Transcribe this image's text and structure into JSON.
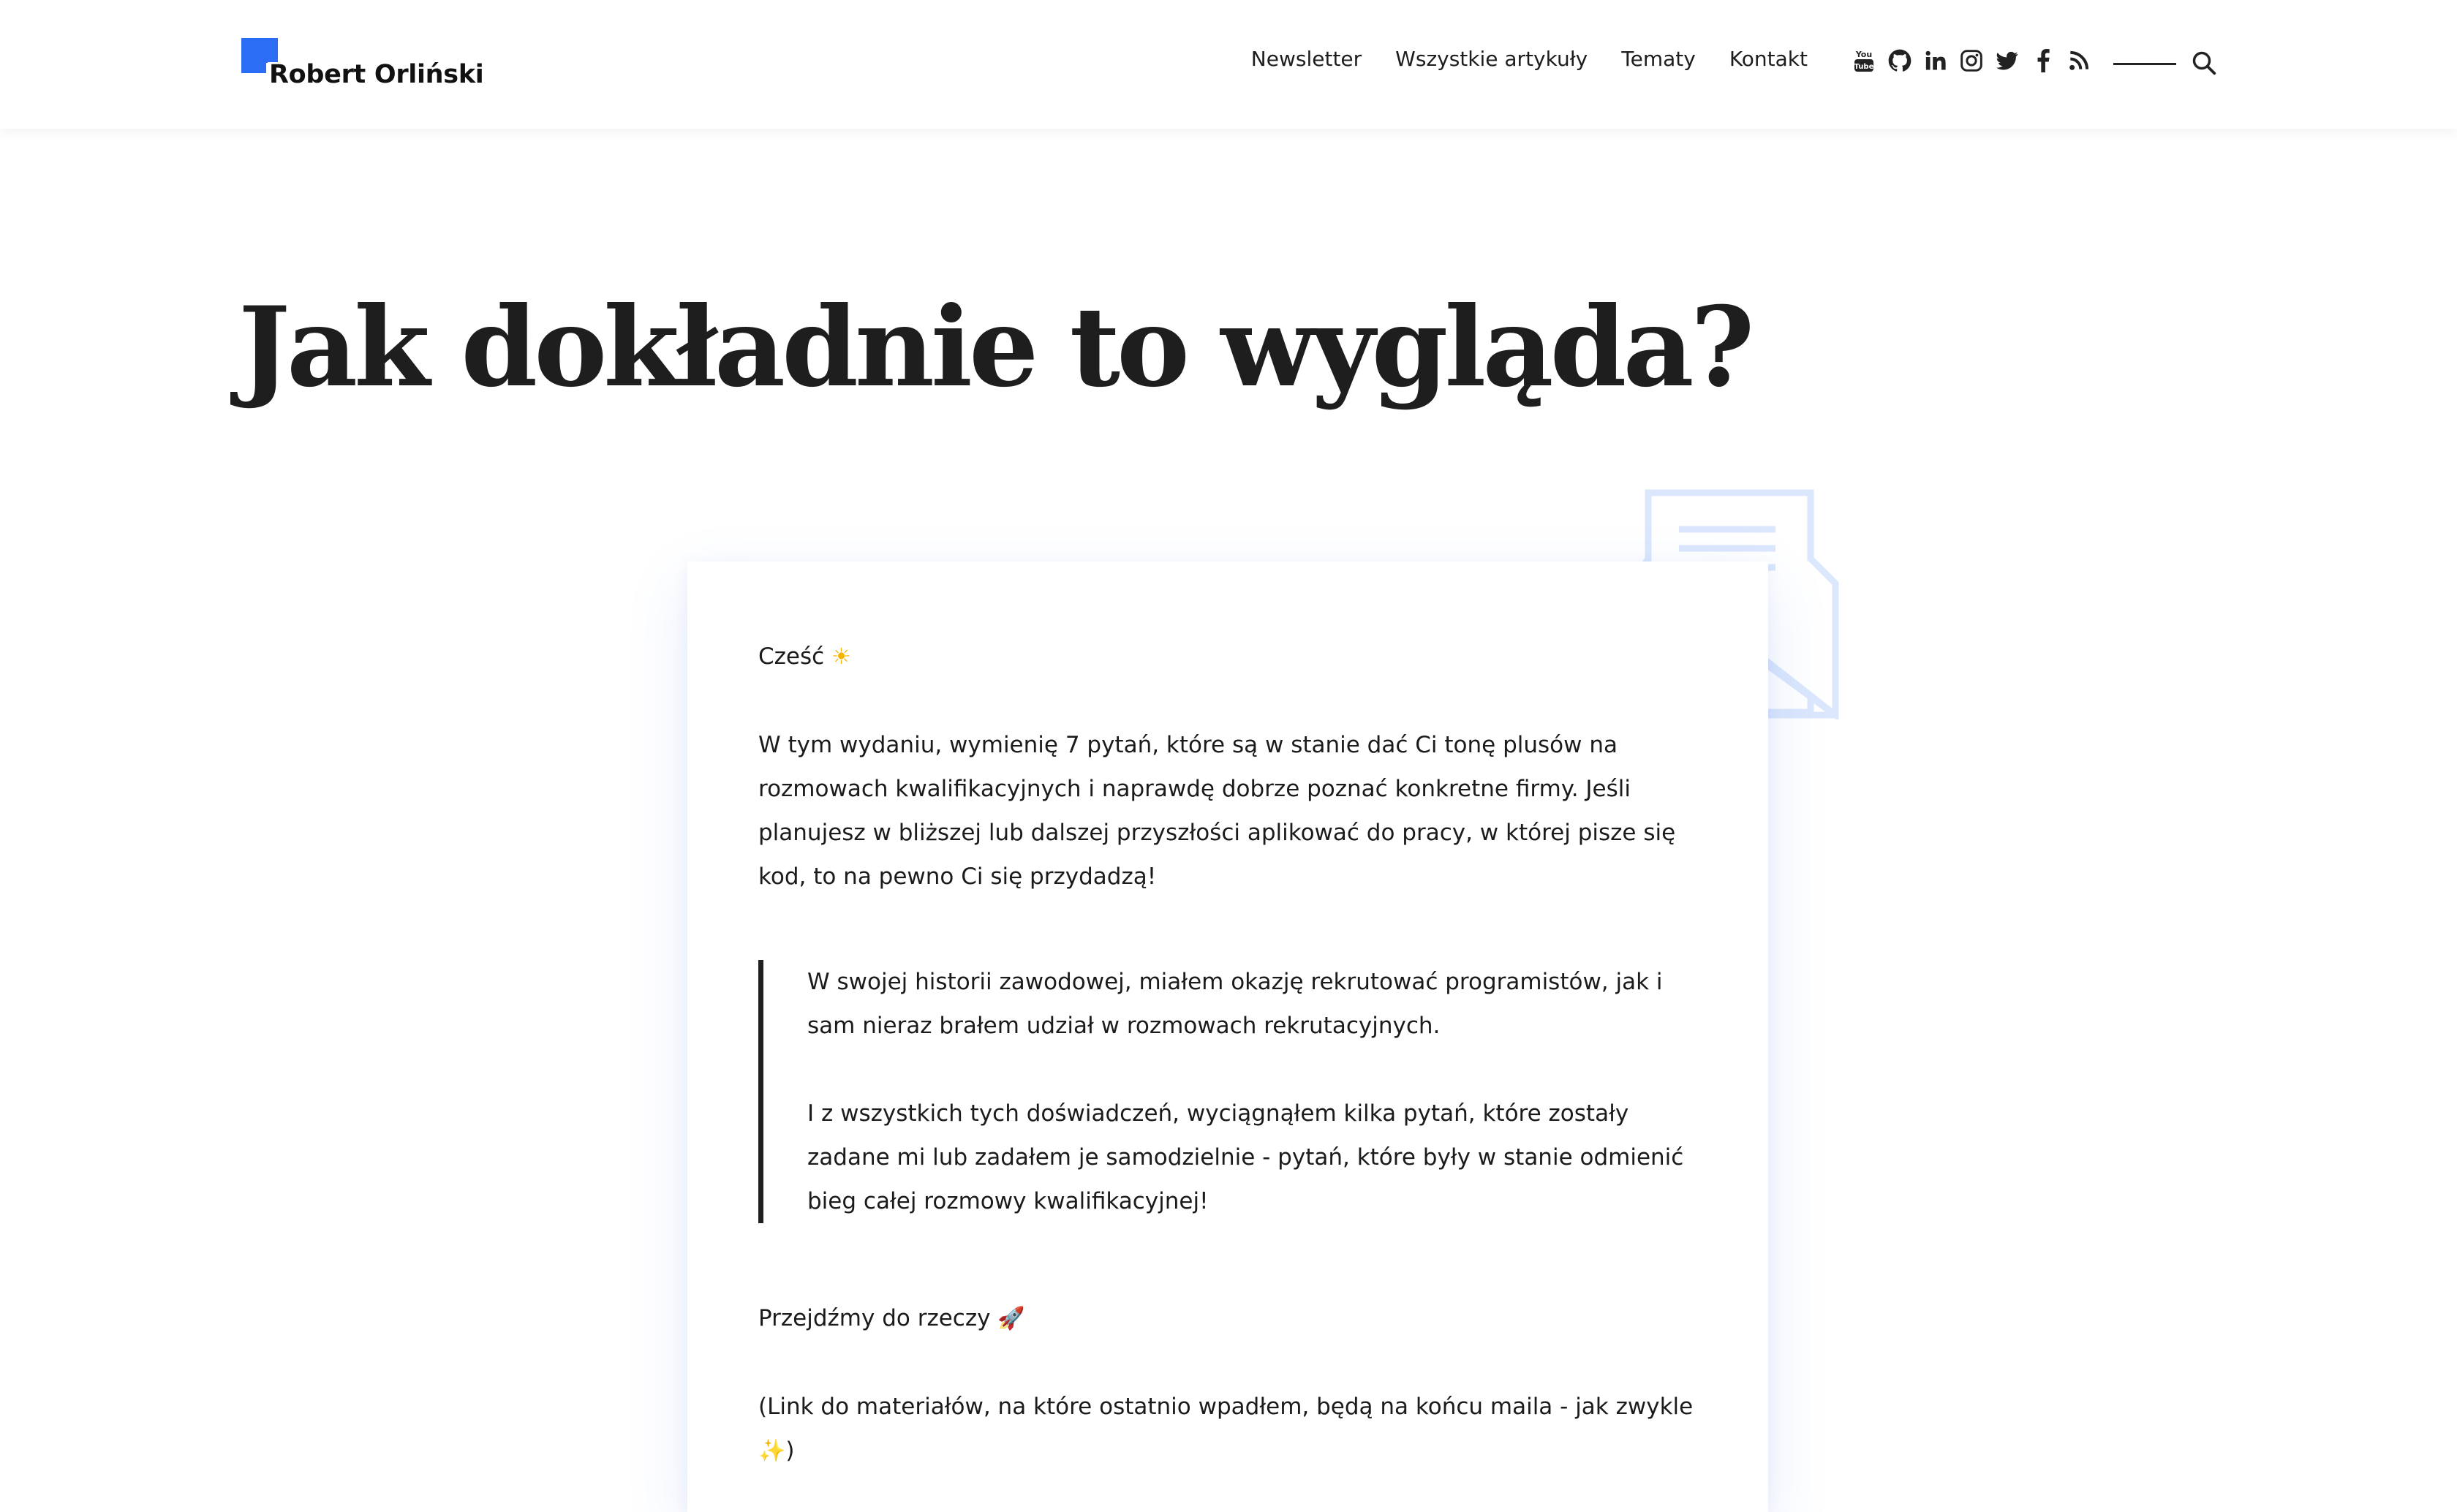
{
  "header": {
    "logo_text": "Robert Orliński",
    "nav": [
      "Newsletter",
      "Wszystkie artykuły",
      "Tematy",
      "Kontakt"
    ],
    "social_icons": [
      "youtube-icon",
      "github-icon",
      "linkedin-icon",
      "instagram-icon",
      "twitter-icon",
      "facebook-icon",
      "rss-icon"
    ],
    "search_icon": "search-icon",
    "brand_color": "#2b6ef5"
  },
  "title": "Jak dokładnie to wygląda?",
  "email": {
    "greeting": "Cześć",
    "greeting_emoji": "☀",
    "intro": "W tym wydaniu, wymienię 7 pytań, które są w stanie dać Ci tonę plusów na rozmowach kwalifikacyjnych i naprawdę dobrze poznać konkretne firmy. Jeśli planujesz w bliższej lub dalszej przyszłości aplikować do pracy, w której pisze się kod, to na pewno Ci się przydadzą!",
    "quote": [
      "W swojej historii zawodowej, miałem okazję rekrutować programistów, jak i sam nieraz brałem udział w rozmowach rekrutacyjnych.",
      "I z wszystkich tych doświadczeń, wyciągnąłem kilka pytań, które zostały zadane mi lub zadałem je samodzielnie - pytań, które były w stanie odmienić bieg całej rozmowy kwalifikacyjnej!"
    ],
    "lets_go": "Przejdźmy do rzeczy",
    "lets_go_emoji": "🚀",
    "links_note": "(Link do materiałów, na które ostatnio wpadłem, będą na końcu maila - jak zwykle",
    "links_note_emoji": "✨",
    "links_note_end": ")"
  },
  "decor": {
    "envelope_color": "#dbe7fd"
  }
}
